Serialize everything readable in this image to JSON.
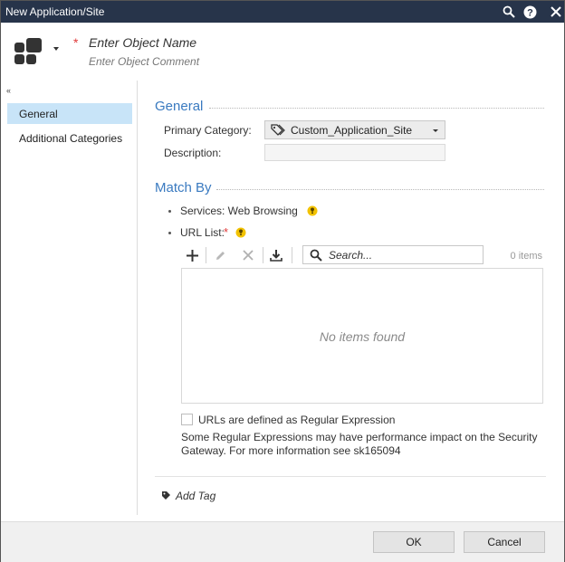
{
  "window": {
    "title": "New Application/Site"
  },
  "header": {
    "object_name_placeholder": "Enter Object Name",
    "object_comment_placeholder": "Enter Object Comment",
    "required_mark": "*"
  },
  "sidebar": {
    "collapse_glyph": "«",
    "items": [
      {
        "label": "General",
        "active": true
      },
      {
        "label": "Additional Categories",
        "active": false
      }
    ]
  },
  "general": {
    "title": "General",
    "primary_category_label": "Primary Category:",
    "primary_category_value": "Custom_Application_Site",
    "description_label": "Description:"
  },
  "match_by": {
    "title": "Match By",
    "services_label": "Services: Web Browsing",
    "url_list_label": "URL List:",
    "required_mark": "*",
    "search_placeholder": "Search...",
    "item_count": "0 items",
    "empty_text": "No items found",
    "regex_checkbox_label": "URLs are defined as Regular Expression",
    "regex_checked": false,
    "regex_note": "Some Regular Expressions may have performance impact on the Security Gateway. For more information see sk165094"
  },
  "tags": {
    "add_tag_label": "Add Tag"
  },
  "footer": {
    "ok_label": "OK",
    "cancel_label": "Cancel"
  },
  "colors": {
    "titlebar": "#27344a",
    "accent": "#3a7ac0",
    "nav_active": "#c8e4f8",
    "required": "#e03a3a"
  }
}
